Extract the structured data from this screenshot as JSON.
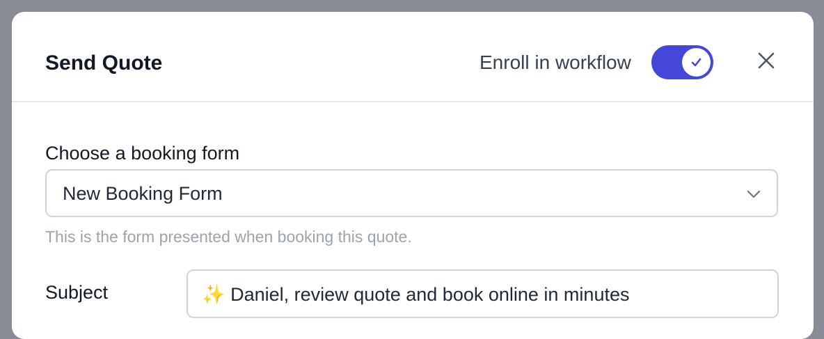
{
  "modal": {
    "title": "Send Quote",
    "enroll_label": "Enroll in workflow",
    "enroll_enabled": true,
    "accent_color": "#4448d8",
    "close_icon": "close-icon"
  },
  "booking_form": {
    "label": "Choose a booking form",
    "selected": "New Booking Form",
    "help": "This is the form presented when booking this quote."
  },
  "subject": {
    "label": "Subject",
    "value": "✨ Daniel, review quote and book online in minutes"
  }
}
